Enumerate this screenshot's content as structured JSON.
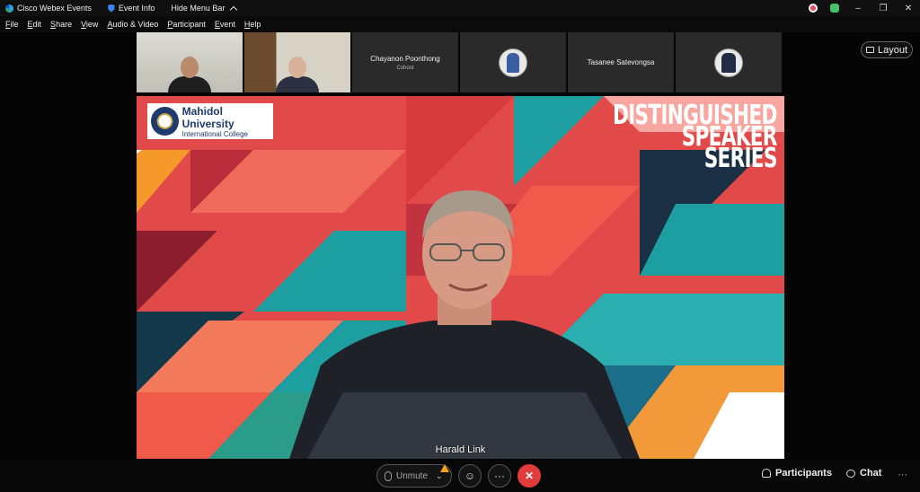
{
  "titlebar": {
    "app_name": "Cisco Webex Events",
    "event_info": "Event Info",
    "hide_menu": "Hide Menu Bar"
  },
  "menu": [
    "File",
    "Edit",
    "Share",
    "View",
    "Audio & Video",
    "Participant",
    "Event",
    "Help"
  ],
  "participants_strip": [
    {
      "name": "",
      "role": ""
    },
    {
      "name": "",
      "role": ""
    },
    {
      "name": "Chayanon Poonthong",
      "role": "Cohost"
    },
    {
      "name": "",
      "role": ""
    },
    {
      "name": "Tasanee Satevongsa",
      "role": ""
    },
    {
      "name": "",
      "role": ""
    }
  ],
  "layout_button": "Layout",
  "stage": {
    "logo_line1": "Mahidol University",
    "logo_line2": "International College",
    "title_line1": "DISTINGUISHED",
    "title_line2": "SPEAKER",
    "title_line3": "SERIES",
    "speaker_name": "Harald Link"
  },
  "controls": {
    "unmute": "Unmute",
    "more": "···",
    "participants": "Participants",
    "chat": "Chat",
    "overflow": "···"
  },
  "colors": {
    "end_call": "#e13b3b",
    "warning": "#f3a41b",
    "banner_red": "#e34b4b",
    "banner_teal": "#1d9ea0"
  }
}
